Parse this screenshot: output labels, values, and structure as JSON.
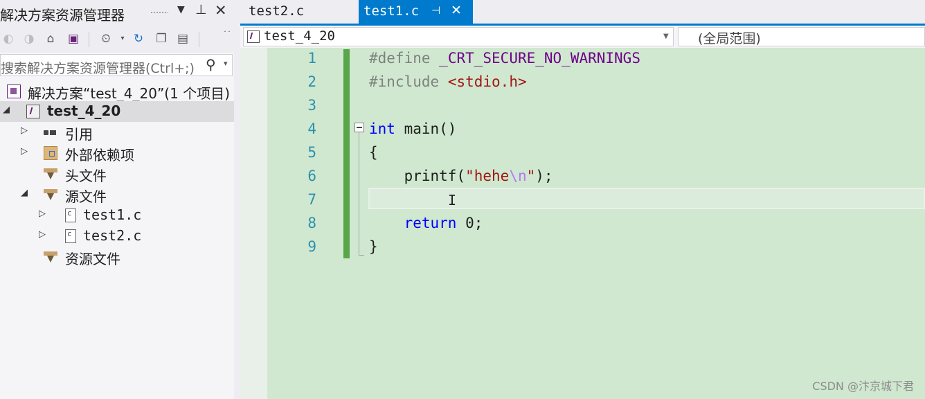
{
  "solution_explorer": {
    "title": "解决方案资源管理器",
    "search_placeholder": "搜索解决方案资源管理器(Ctrl+;)",
    "toolbar_icons": [
      "back-icon",
      "forward-icon",
      "home-icon",
      "vs-switch-views-icon",
      "pending-changes-filter-icon",
      "refresh-icon",
      "collapse-all-icon",
      "properties-icon"
    ],
    "tree": [
      {
        "label": "解决方案“test_4_20”(1 个项目)",
        "icon": "solution-icon",
        "level": 0
      },
      {
        "label": "test_4_20",
        "icon": "cpp-project-icon",
        "level": 0,
        "bold": true,
        "selected": true,
        "expanded": true
      },
      {
        "label": "引用",
        "icon": "references-icon",
        "level": 1,
        "expandable": true
      },
      {
        "label": "外部依赖项",
        "icon": "external-dependencies-icon",
        "level": 1,
        "expandable": true
      },
      {
        "label": "头文件",
        "icon": "filter-folder-icon",
        "level": 1
      },
      {
        "label": "源文件",
        "icon": "filter-folder-icon",
        "level": 1,
        "expanded": true
      },
      {
        "label": "test1.c",
        "icon": "c-file-icon",
        "level": 2,
        "expandable": true
      },
      {
        "label": "test2.c",
        "icon": "c-file-icon",
        "level": 2,
        "expandable": true
      },
      {
        "label": "资源文件",
        "icon": "filter-folder-icon",
        "level": 1
      }
    ]
  },
  "tabs": [
    {
      "label": "test2.c",
      "active": false
    },
    {
      "label": "test1.c",
      "active": true
    }
  ],
  "navigation": {
    "project": "test_4_20",
    "scope": "(全局范围)"
  },
  "editor": {
    "line_numbers": [
      "1",
      "2",
      "3",
      "4",
      "5",
      "6",
      "7",
      "8",
      "9"
    ],
    "lines": [
      {
        "directive": "#define",
        "macro": "_CRT_SECURE_NO_WARNINGS"
      },
      {
        "directive": "#include",
        "header": "<stdio.h>"
      },
      {},
      {
        "kw": "int",
        "rest": "main()"
      },
      {
        "text": "{"
      },
      {
        "fn": "printf(",
        "str1": "\"hehe",
        "esc": "\\n",
        "str2": "\"",
        "tail": ");"
      },
      {
        "text": ""
      },
      {
        "kw": "return",
        "rest": "0;"
      },
      {
        "text": "}"
      }
    ],
    "current_line": 7
  },
  "colors": {
    "accent": "#007acc",
    "editor_bg": "#cfe8cf",
    "change_bar": "#57a64a",
    "line_number": "#2b91af",
    "keyword": "#0000ff",
    "string": "#a31515",
    "macro": "#6f008a"
  },
  "watermark": "CSDN @汴京城下君"
}
